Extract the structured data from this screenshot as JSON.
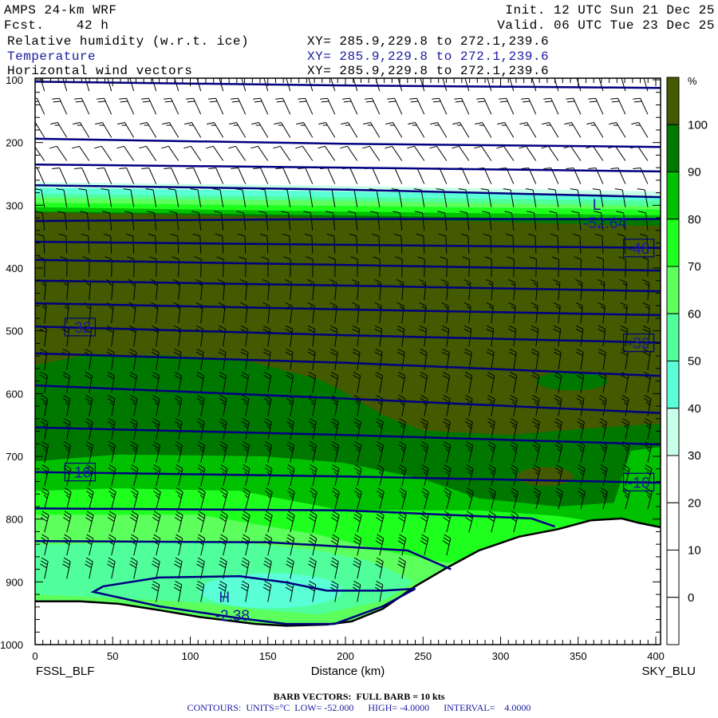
{
  "header": {
    "model": "AMPS 24-km WRF",
    "forecast": "Fcst.    42 h",
    "init": "Init. 12 UTC Sun 21 Dec 25",
    "valid": "Valid. 06 UTC Tue 23 Dec 25",
    "fields": [
      {
        "name": "Relative humidity (w.r.t. ice)",
        "xy": "XY= 285.9,229.8 to 272.1,239.6"
      },
      {
        "name": "Temperature",
        "xy": "XY= 285.9,229.8 to 272.1,239.6"
      },
      {
        "name": "Horizontal wind vectors",
        "xy": "XY= 285.9,229.8 to 272.1,239.6"
      }
    ]
  },
  "footer": {
    "barb": "BARB VECTORS:  FULL BARB = 10 kts",
    "contours": "CONTOURS:  UNITS=°C  LOW= -52.000      HIGH= -4.0000      INTERVAL=    4.0000"
  },
  "chart_data": {
    "type": "cross-section",
    "xlabel": "Distance (km)",
    "x_range": [
      0,
      403
    ],
    "y_range_mb": [
      100,
      1000
    ],
    "x_ticks": [
      "0",
      "50",
      "100",
      "150",
      "200",
      "250",
      "300",
      "350",
      "400"
    ],
    "y_ticks": [
      "100",
      "200",
      "300",
      "400",
      "500",
      "600",
      "700",
      "800",
      "900",
      "1000"
    ],
    "start_point": "FSSL_BLF",
    "end_point": "SKY_BLU",
    "colorbar": {
      "unit": "%",
      "labels": [
        "100",
        "90",
        "80",
        "70",
        "60",
        "50",
        "40",
        "30",
        "20",
        "10",
        "0"
      ],
      "colors": [
        "#435a00",
        "#007800",
        "#00c000",
        "#1eff1e",
        "#5cff5c",
        "#50ff9c",
        "#5affd8",
        "#c8ffe8",
        "#ffffff",
        "#ffffff",
        "#ffffff",
        "#ffffff"
      ]
    },
    "rh_colors": {
      "30": "#c8ffe8",
      "40": "#5affd8",
      "50": "#50ff9c",
      "60": "#5cff5c",
      "70": "#1eff1e",
      "80": "#00c000",
      "90": "#007800",
      "100": "#435a00"
    },
    "rh_regions_below": [
      {
        "level": "30",
        "boundary": [
          [
            0,
            263
          ],
          [
            198,
            269
          ],
          [
            403,
            278
          ]
        ]
      },
      {
        "level": "40",
        "boundary": [
          [
            0,
            272
          ],
          [
            198,
            278
          ],
          [
            403,
            286
          ]
        ]
      },
      {
        "level": "50",
        "boundary": [
          [
            0,
            282
          ],
          [
            198,
            287
          ],
          [
            403,
            293
          ]
        ]
      },
      {
        "level": "60",
        "boundary": [
          [
            0,
            288
          ],
          [
            198,
            293
          ],
          [
            403,
            301
          ]
        ]
      },
      {
        "level": "70",
        "boundary": [
          [
            0,
            296
          ],
          [
            198,
            301
          ],
          [
            403,
            307
          ]
        ]
      },
      {
        "level": "80",
        "boundary": [
          [
            0,
            303
          ],
          [
            198,
            310
          ],
          [
            403,
            316
          ]
        ]
      },
      {
        "level": "90",
        "boundary": [
          [
            0,
            310
          ],
          [
            198,
            316
          ],
          [
            403,
            324
          ]
        ]
      },
      {
        "level": "100",
        "boundary": [
          [
            0,
            311
          ],
          [
            198,
            320
          ],
          [
            403,
            333
          ]
        ]
      },
      {
        "level": "90",
        "boundary": [
          [
            0,
            555
          ],
          [
            29,
            540
          ],
          [
            80,
            539
          ],
          [
            132,
            545
          ],
          [
            183,
            577
          ],
          [
            198,
            596
          ],
          [
            224,
            634
          ],
          [
            250,
            659
          ],
          [
            306,
            666
          ],
          [
            348,
            657
          ],
          [
            389,
            650
          ],
          [
            403,
            648
          ]
        ]
      },
      {
        "level": "80",
        "boundary": [
          [
            0,
            708
          ],
          [
            54,
            697
          ],
          [
            147,
            700
          ],
          [
            198,
            710
          ],
          [
            250,
            736
          ],
          [
            286,
            767
          ],
          [
            337,
            780
          ],
          [
            373,
            774
          ],
          [
            384,
            691
          ],
          [
            403,
            685
          ]
        ]
      },
      {
        "level": "70",
        "boundary": [
          [
            0,
            755
          ],
          [
            54,
            751
          ],
          [
            132,
            755
          ],
          [
            198,
            786
          ],
          [
            286,
            786
          ],
          [
            337,
            795
          ],
          [
            403,
            820
          ]
        ]
      },
      {
        "level": "60",
        "boundary": [
          [
            0,
            793
          ],
          [
            106,
            793
          ],
          [
            183,
            825
          ],
          [
            224,
            850
          ],
          [
            265,
            869
          ],
          [
            403,
            900
          ]
        ]
      },
      {
        "level": "50",
        "boundary": [
          [
            0,
            841
          ],
          [
            80,
            837
          ],
          [
            132,
            837
          ],
          [
            183,
            850
          ],
          [
            219,
            869
          ],
          [
            245,
            901
          ],
          [
            403,
            950
          ]
        ]
      },
      {
        "level": "60",
        "boundary": [
          [
            0,
            920
          ],
          [
            54,
            926
          ],
          [
            106,
            933
          ],
          [
            147,
            945
          ],
          [
            183,
            952
          ],
          [
            224,
            930
          ],
          [
            265,
            870
          ],
          [
            403,
            820
          ]
        ]
      }
    ],
    "rh_blobs": [
      {
        "level": "40",
        "center": [
          152,
          914
        ],
        "radius_km": 46,
        "radius_mb": 28
      },
      {
        "level": "100",
        "center": [
          329,
          732
        ],
        "radius_km": 18,
        "radius_mb": 15
      },
      {
        "level": "90",
        "center": [
          346,
          580
        ],
        "radius_km": 23,
        "radius_mb": 15
      }
    ],
    "terrain_mb": [
      [
        0,
        931
      ],
      [
        29,
        931
      ],
      [
        54,
        935
      ],
      [
        80,
        945
      ],
      [
        106,
        956
      ],
      [
        142,
        967
      ],
      [
        162,
        970
      ],
      [
        188,
        968
      ],
      [
        204,
        963
      ],
      [
        224,
        943
      ],
      [
        245,
        907
      ],
      [
        265,
        878
      ],
      [
        286,
        850
      ],
      [
        312,
        828
      ],
      [
        337,
        816
      ],
      [
        358,
        802
      ],
      [
        378,
        799
      ],
      [
        389,
        806
      ],
      [
        403,
        813
      ]
    ],
    "temperature_contours": [
      {
        "value": -36,
        "points": [
          [
            0,
            103
          ],
          [
            200,
            109
          ],
          [
            403,
            113
          ]
        ]
      },
      {
        "value": -40,
        "points": [
          [
            0,
            194
          ],
          [
            200,
            202
          ],
          [
            403,
            207
          ]
        ]
      },
      {
        "value": -44,
        "points": [
          [
            0,
            235
          ],
          [
            200,
            240
          ],
          [
            403,
            246
          ]
        ]
      },
      {
        "value": -48,
        "points": [
          [
            0,
            268
          ],
          [
            200,
            275
          ],
          [
            403,
            287
          ]
        ]
      },
      {
        "value": -52,
        "points": [
          [
            0,
            325
          ],
          [
            200,
            322
          ],
          [
            403,
            322
          ]
        ]
      },
      {
        "value": -48,
        "points": [
          [
            0,
            358
          ],
          [
            200,
            363
          ],
          [
            403,
            368
          ]
        ]
      },
      {
        "value": -44,
        "points": [
          [
            0,
            387
          ],
          [
            200,
            395
          ],
          [
            403,
            404
          ]
        ]
      },
      {
        "value": -40,
        "points": [
          [
            0,
            420
          ],
          [
            200,
            428
          ],
          [
            403,
            437
          ]
        ]
      },
      {
        "value": -36,
        "points": [
          [
            0,
            456
          ],
          [
            200,
            466
          ],
          [
            403,
            475
          ]
        ]
      },
      {
        "value": -32,
        "points": [
          [
            0,
            493
          ],
          [
            200,
            507
          ],
          [
            403,
            519
          ]
        ]
      },
      {
        "value": -28,
        "points": [
          [
            0,
            536
          ],
          [
            200,
            551
          ],
          [
            403,
            572
          ]
        ]
      },
      {
        "value": -24,
        "points": [
          [
            0,
            587
          ],
          [
            200,
            608
          ],
          [
            403,
            631
          ]
        ]
      },
      {
        "value": -20,
        "points": [
          [
            0,
            654
          ],
          [
            200,
            666
          ],
          [
            403,
            681
          ]
        ]
      },
      {
        "value": -16,
        "points": [
          [
            0,
            725
          ],
          [
            200,
            732
          ],
          [
            403,
            742
          ]
        ]
      },
      {
        "value": -12,
        "points": [
          [
            0,
            783
          ],
          [
            200,
            786
          ],
          [
            320,
            799
          ],
          [
            335,
            812
          ]
        ]
      },
      {
        "value": -8,
        "points": [
          [
            0,
            835
          ],
          [
            150,
            837
          ],
          [
            240,
            850
          ],
          [
            268,
            880
          ]
        ]
      },
      {
        "value": -4,
        "closed": true,
        "points": [
          [
            37.5,
            916
          ],
          [
            44,
            907
          ],
          [
            80,
            893
          ],
          [
            132,
            891
          ],
          [
            162,
            901
          ],
          [
            188,
            914
          ],
          [
            224,
            914
          ],
          [
            245,
            911
          ],
          [
            224,
            939
          ],
          [
            193,
            967
          ],
          [
            162,
            967
          ],
          [
            132,
            958
          ],
          [
            80,
            939
          ]
        ]
      }
    ],
    "contour_labels": [
      {
        "text": "-32",
        "at": [
          29,
          494
        ]
      },
      {
        "text": "-32",
        "at": [
          389,
          519
        ]
      },
      {
        "text": "-48",
        "at": [
          389,
          368
        ]
      },
      {
        "text": "-16",
        "at": [
          29,
          725
        ]
      },
      {
        "text": "-16",
        "at": [
          389,
          741
        ]
      }
    ],
    "extrema": [
      {
        "mark": "L",
        "value": "-52.64",
        "at": [
          362,
          298
        ]
      },
      {
        "mark": "H",
        "value": "-2.38",
        "at": [
          122,
          924
        ]
      }
    ],
    "wind_profile": [
      {
        "p": 110,
        "dir_deg": 345,
        "speed_kt": 25
      },
      {
        "p": 180,
        "dir_deg": 330,
        "speed_kt": 20
      },
      {
        "p": 240,
        "dir_deg": 325,
        "speed_kt": 10
      },
      {
        "p": 300,
        "dir_deg": 350,
        "speed_kt": 10
      },
      {
        "p": 450,
        "dir_deg": 5,
        "speed_kt": 15
      },
      {
        "p": 600,
        "dir_deg": 10,
        "speed_kt": 25
      },
      {
        "p": 800,
        "dir_deg": 15,
        "speed_kt": 30
      },
      {
        "p": 950,
        "dir_deg": 10,
        "speed_kt": 35
      }
    ]
  }
}
